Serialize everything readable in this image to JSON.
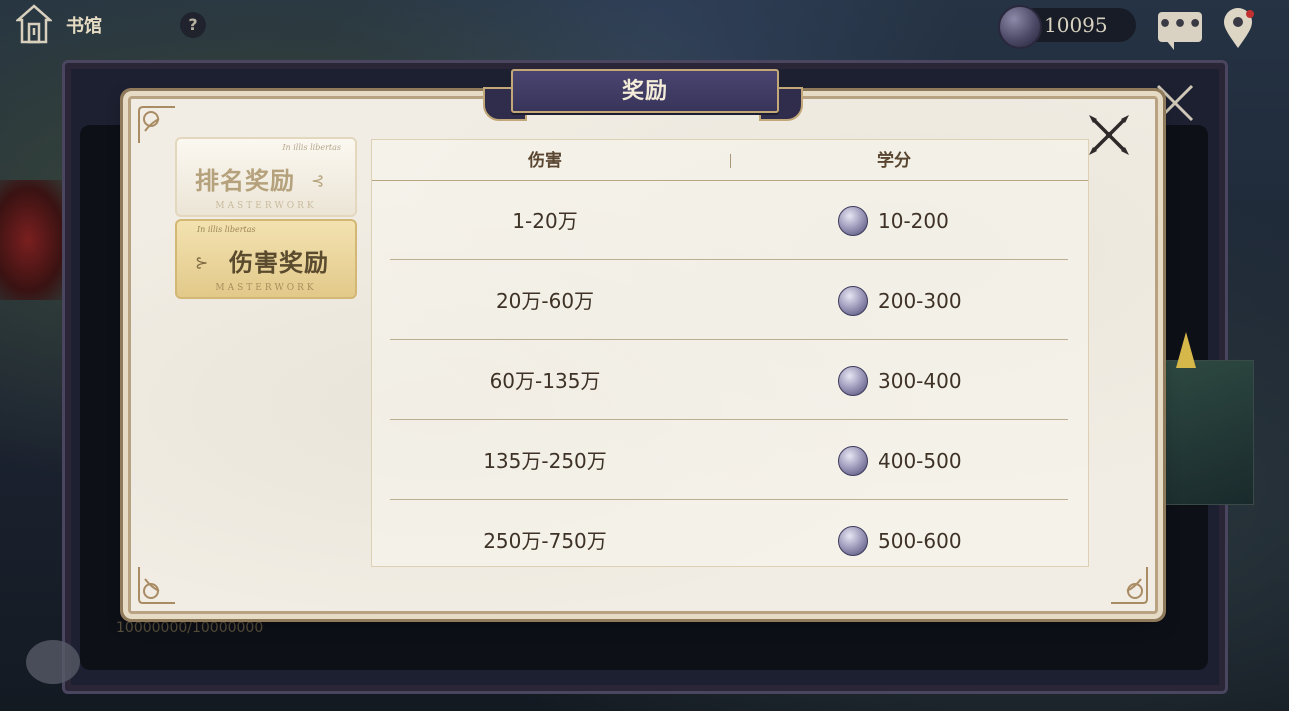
{
  "topbar": {
    "home_label": "书馆",
    "help_label": "?",
    "currency_value": "10095",
    "chat_label": "•••"
  },
  "dialog": {
    "title": "奖励",
    "tabs": [
      {
        "label": "排名奖励",
        "small_top": "In illis libertas",
        "small_bottom": "MASTERWORK",
        "flourish": "⊰",
        "active": false
      },
      {
        "label": "伤害奖励",
        "small_top": "In illis libertas",
        "small_bottom": "MASTERWORK",
        "flourish": "⊱",
        "active": true
      }
    ],
    "table": {
      "headers": {
        "damage": "伤害",
        "credit": "学分"
      },
      "rows": [
        {
          "damage": "1-20万",
          "credit": "10-200"
        },
        {
          "damage": "20万-60万",
          "credit": "200-300"
        },
        {
          "damage": "60万-135万",
          "credit": "300-400"
        },
        {
          "damage": "135万-250万",
          "credit": "400-500"
        },
        {
          "damage": "250万-750万",
          "credit": "500-600"
        }
      ]
    }
  },
  "background": {
    "bottom_text": "10000000/10000000"
  },
  "colors": {
    "banner": "#38345a",
    "parchment": "#f1ede4",
    "gold_border": "#b9a282",
    "active_tab": "#e2c98a"
  },
  "icons": {
    "home": "home-icon",
    "help": "help-icon",
    "currency": "credit-coin-icon",
    "chat": "chat-icon",
    "map": "map-pin-icon",
    "close": "close-icon"
  }
}
